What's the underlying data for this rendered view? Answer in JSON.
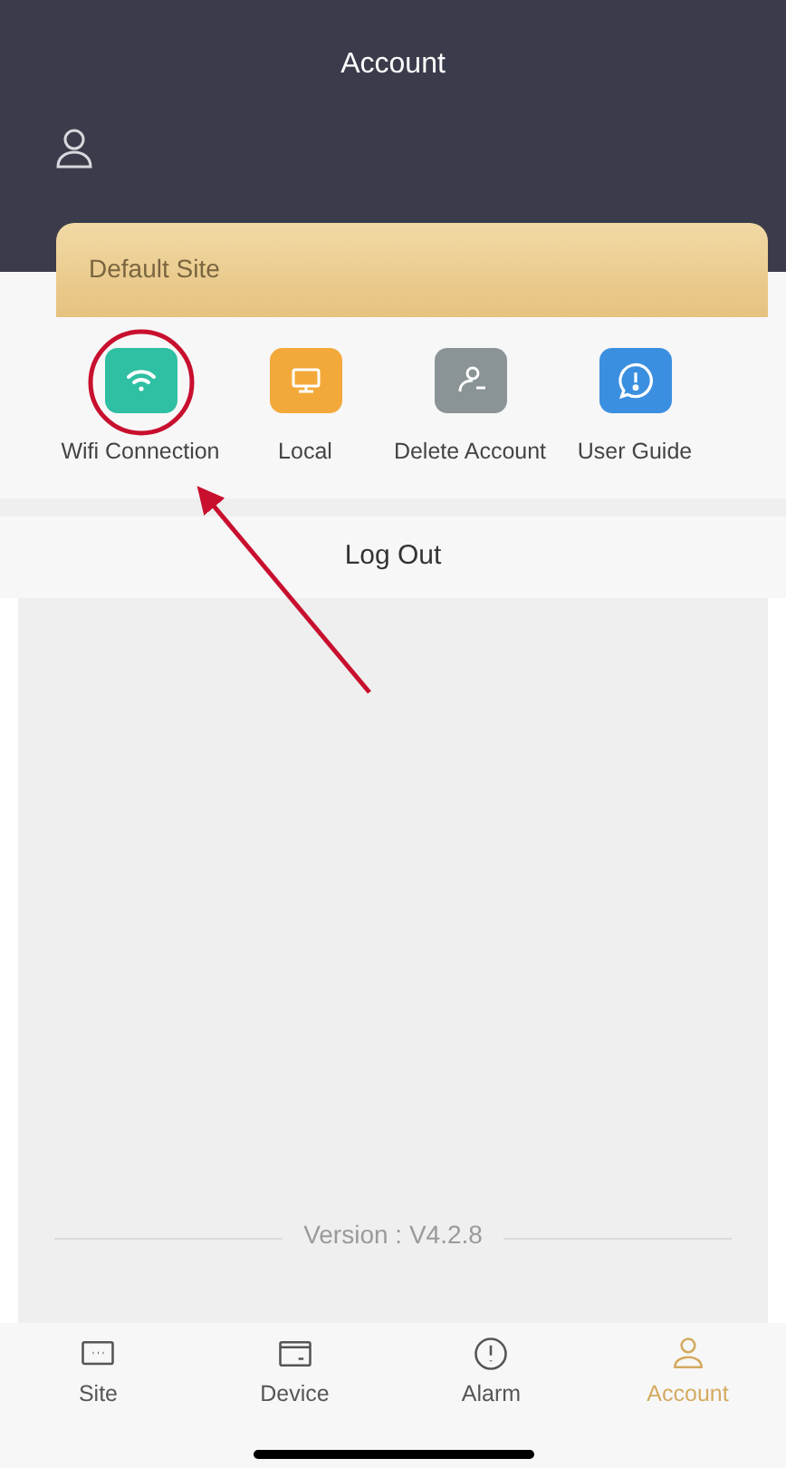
{
  "header": {
    "title": "Account"
  },
  "site_card": {
    "label": "Default Site"
  },
  "actions": [
    {
      "label": "Wifi Connection"
    },
    {
      "label": "Local"
    },
    {
      "label": "Delete Account"
    },
    {
      "label": "User Guide"
    }
  ],
  "logout": {
    "label": "Log Out"
  },
  "version": "Version : V4.2.8",
  "tabs": [
    {
      "label": "Site",
      "selected": false
    },
    {
      "label": "Device",
      "selected": false
    },
    {
      "label": "Alarm",
      "selected": false
    },
    {
      "label": "Account",
      "selected": true
    }
  ]
}
